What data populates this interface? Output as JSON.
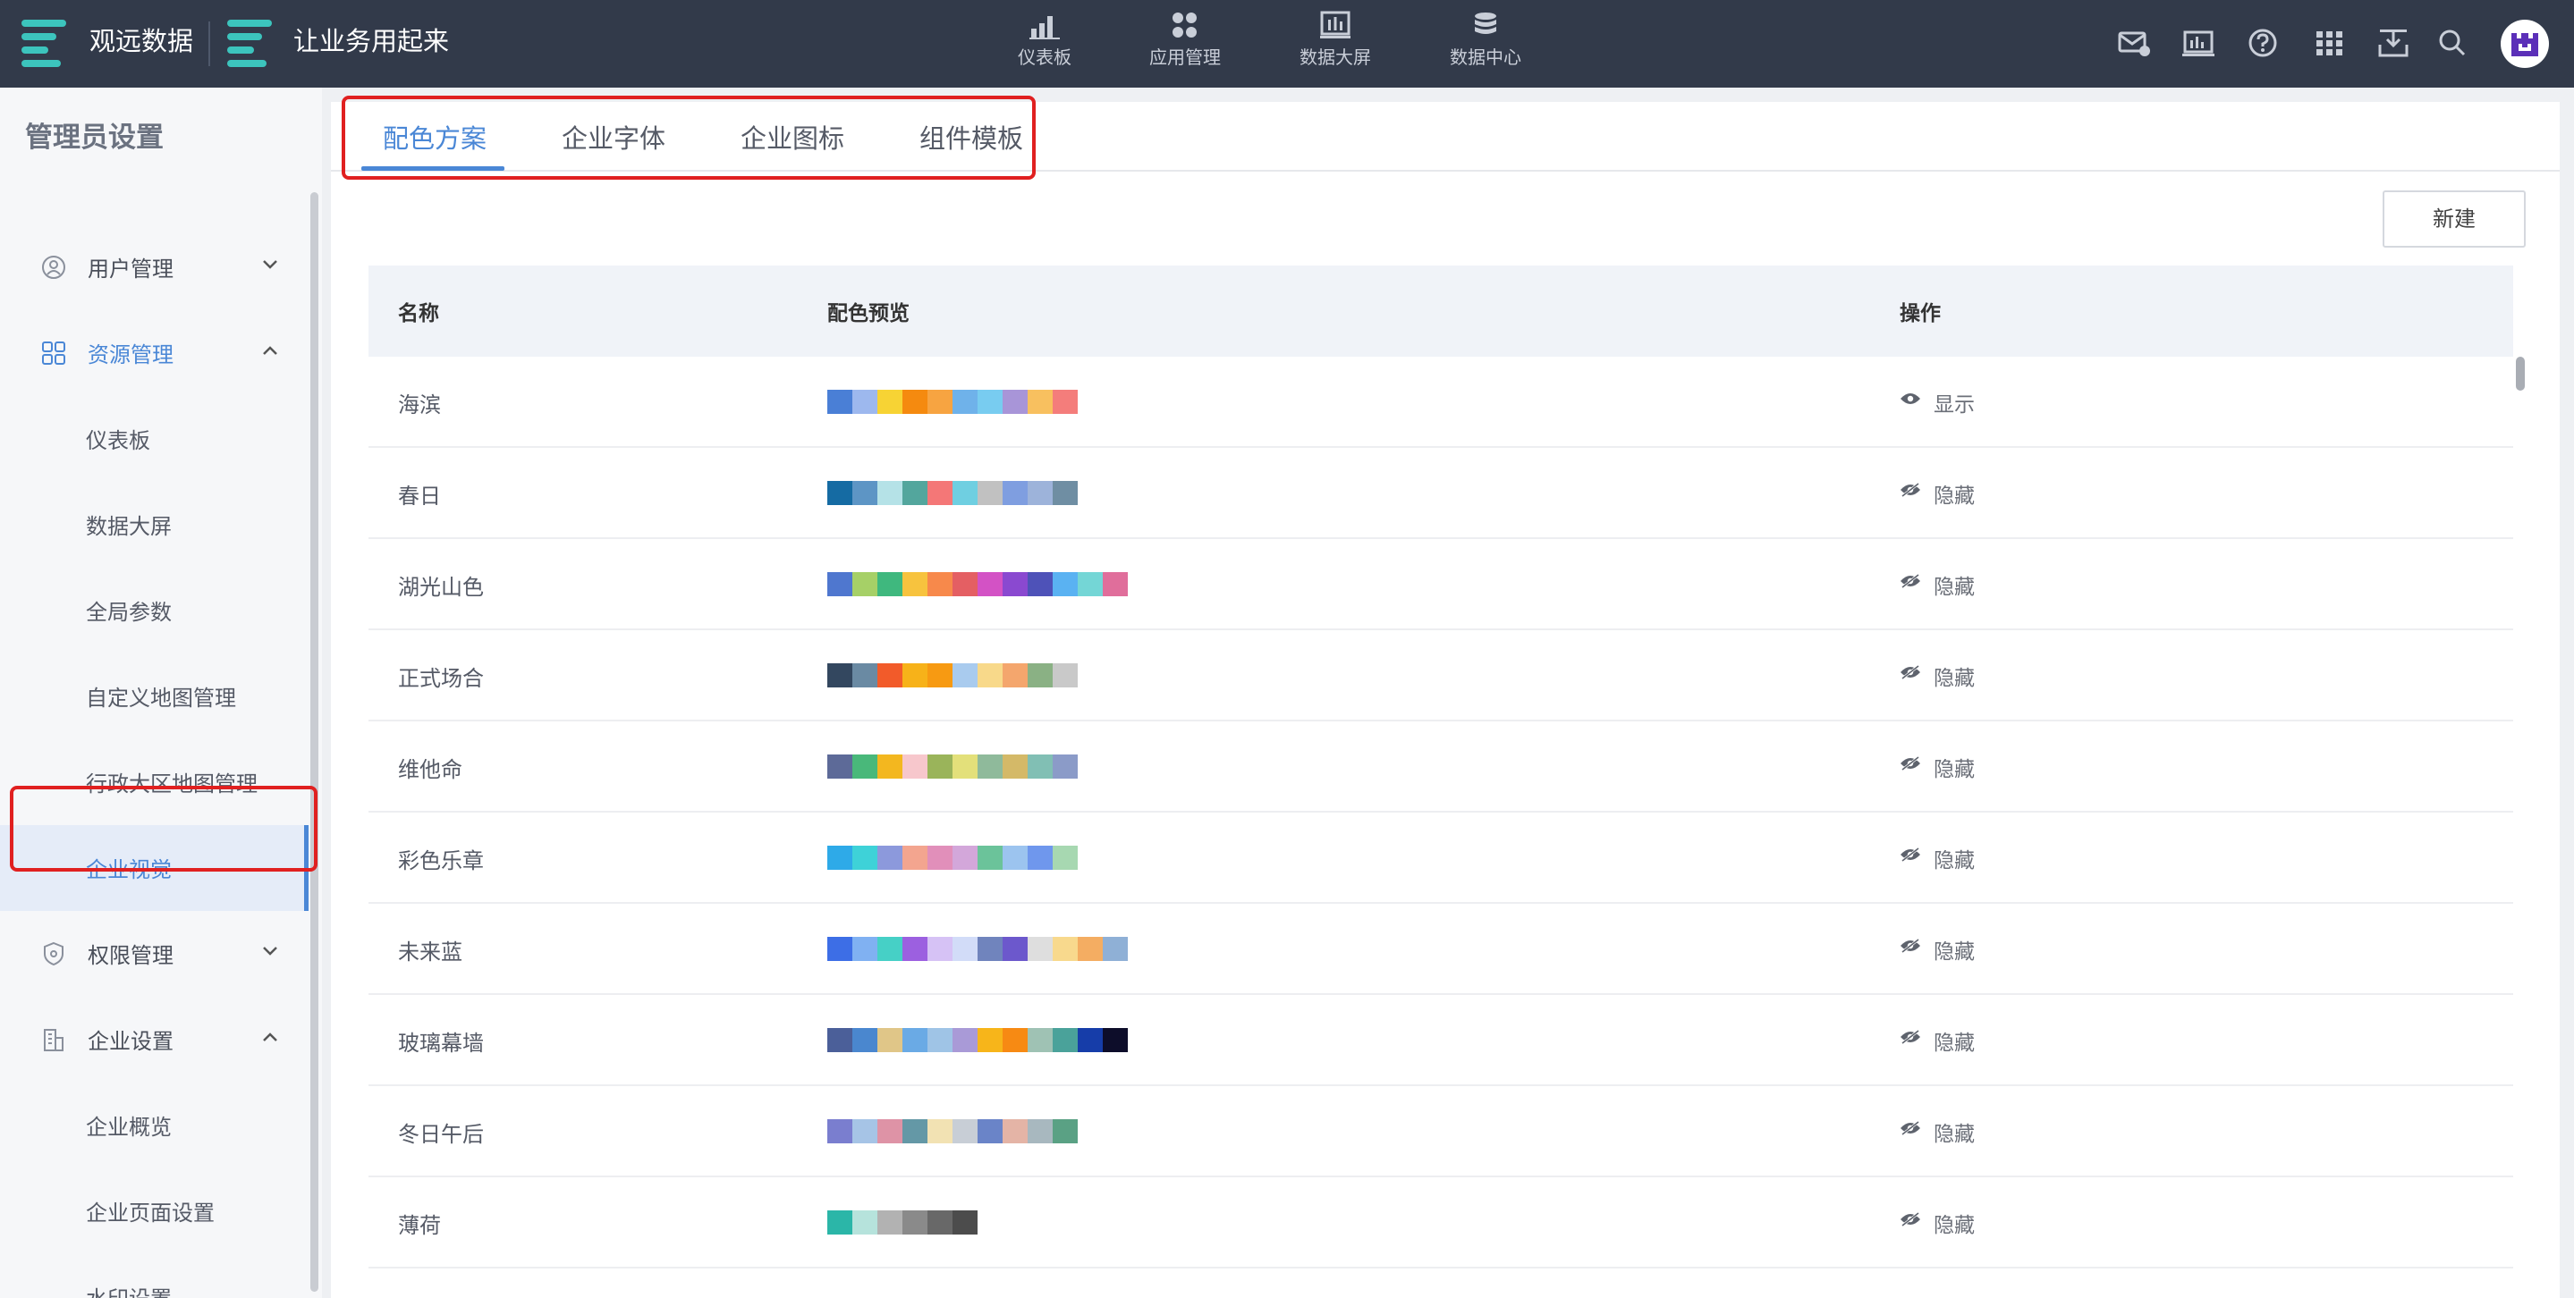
{
  "topbar": {
    "brand_name": "观远数据",
    "app_name": "让业务用起来",
    "nav": [
      {
        "label": "仪表板",
        "icon": "bar-chart-icon"
      },
      {
        "label": "应用管理",
        "icon": "apps-cluster-icon"
      },
      {
        "label": "数据大屏",
        "icon": "big-screen-icon"
      },
      {
        "label": "数据中心",
        "icon": "database-icon"
      }
    ],
    "right_icons": [
      "message-icon",
      "report-icon",
      "help-icon",
      "grid-menu-icon",
      "download-icon",
      "search-icon"
    ],
    "colors": {
      "background": "#323a4a",
      "logo": "#3cc4bd"
    }
  },
  "sidebar": {
    "title": "管理员设置",
    "groups": [
      {
        "label": "用户管理",
        "icon": "user-icon",
        "expanded": false
      },
      {
        "label": "资源管理",
        "icon": "resource-icon",
        "expanded": true,
        "items": [
          "仪表板",
          "数据大屏",
          "全局参数",
          "自定义地图管理",
          "行政大区地图管理",
          "企业视觉"
        ]
      },
      {
        "label": "权限管理",
        "icon": "shield-icon",
        "expanded": false
      },
      {
        "label": "企业设置",
        "icon": "building-icon",
        "expanded": true,
        "items": [
          "企业概览",
          "企业页面设置",
          "水印设置"
        ]
      }
    ],
    "selected": "企业视觉",
    "accent": "#4a87d6"
  },
  "tabs": [
    "配色方案",
    "企业字体",
    "企业图标",
    "组件模板"
  ],
  "active_tab": "配色方案",
  "new_button_label": "新建",
  "table": {
    "headers": [
      "名称",
      "配色预览",
      "操作"
    ],
    "rows": [
      {
        "name": "海滨",
        "action": "显示",
        "colors": [
          "#4a7fd6",
          "#9db8ee",
          "#f7d334",
          "#f58a0f",
          "#f7a441",
          "#6fb2ea",
          "#78ccf0",
          "#a895d8",
          "#f8c05f",
          "#f47d7b"
        ]
      },
      {
        "name": "春日",
        "action": "隐藏",
        "colors": [
          "#156ba3",
          "#5d95c5",
          "#b5e2e7",
          "#53a69d",
          "#f47777",
          "#6fcfe1",
          "#c1c1c1",
          "#7f9ee0",
          "#9db3da",
          "#6f8ea3"
        ]
      },
      {
        "name": "湖光山色",
        "action": "隐藏",
        "colors": [
          "#4f77cf",
          "#a6d067",
          "#3fb87e",
          "#f7c33e",
          "#f7894b",
          "#e45f63",
          "#d352c5",
          "#8a49d0",
          "#4e52b8",
          "#5ab2f2",
          "#74d6d6",
          "#e06e9b"
        ]
      },
      {
        "name": "正式场合",
        "action": "隐藏",
        "colors": [
          "#33475f",
          "#6a8aa3",
          "#f25b2a",
          "#f7b219",
          "#f79a12",
          "#a9cbee",
          "#f8d98a",
          "#f4a66d",
          "#8ab184",
          "#c9c9c9"
        ]
      },
      {
        "name": "维他命",
        "action": "隐藏",
        "colors": [
          "#5d6a98",
          "#49b87a",
          "#f3b71f",
          "#f7c7cc",
          "#9ab45a",
          "#e3e07a",
          "#8fba9b",
          "#d4b968",
          "#81bfb4",
          "#8b9bc8"
        ]
      },
      {
        "name": "彩色乐章",
        "action": "隐藏",
        "colors": [
          "#2eaae8",
          "#3ed2d8",
          "#8c99dc",
          "#f3a58f",
          "#e18fba",
          "#d3a7da",
          "#6bc39a",
          "#9cc4ef",
          "#6f97ed",
          "#a7d8b1"
        ]
      },
      {
        "name": "未来蓝",
        "action": "隐藏",
        "colors": [
          "#3d6ee6",
          "#80b1f2",
          "#46d0c6",
          "#9c60e0",
          "#d6c2f5",
          "#d2dcf8",
          "#7084bd",
          "#6c58cc",
          "#dedede",
          "#f8d98d",
          "#f4ad62",
          "#8fb0d6"
        ]
      },
      {
        "name": "玻璃幕墙",
        "action": "隐藏",
        "colors": [
          "#4b5f99",
          "#4a87cf",
          "#e0c688",
          "#6aaae5",
          "#9fc4e6",
          "#a99ad7",
          "#f7b51a",
          "#f78a13",
          "#9fc2b4",
          "#4aa29a",
          "#163da9",
          "#0d0d2a"
        ]
      },
      {
        "name": "冬日午后",
        "action": "隐藏",
        "colors": [
          "#7a7ecf",
          "#a6c4e6",
          "#de93a6",
          "#6498a6",
          "#f2e2b3",
          "#c8ced6",
          "#6a84c8",
          "#e4b4a6",
          "#a8b8bf",
          "#5aa184"
        ]
      },
      {
        "name": "薄荷",
        "action": "隐藏",
        "colors": [
          "#2bb6a8",
          "#b6e3dc",
          "#b2b2b2",
          "#8a8a8a",
          "#686868",
          "#4c4c4c"
        ]
      }
    ]
  }
}
